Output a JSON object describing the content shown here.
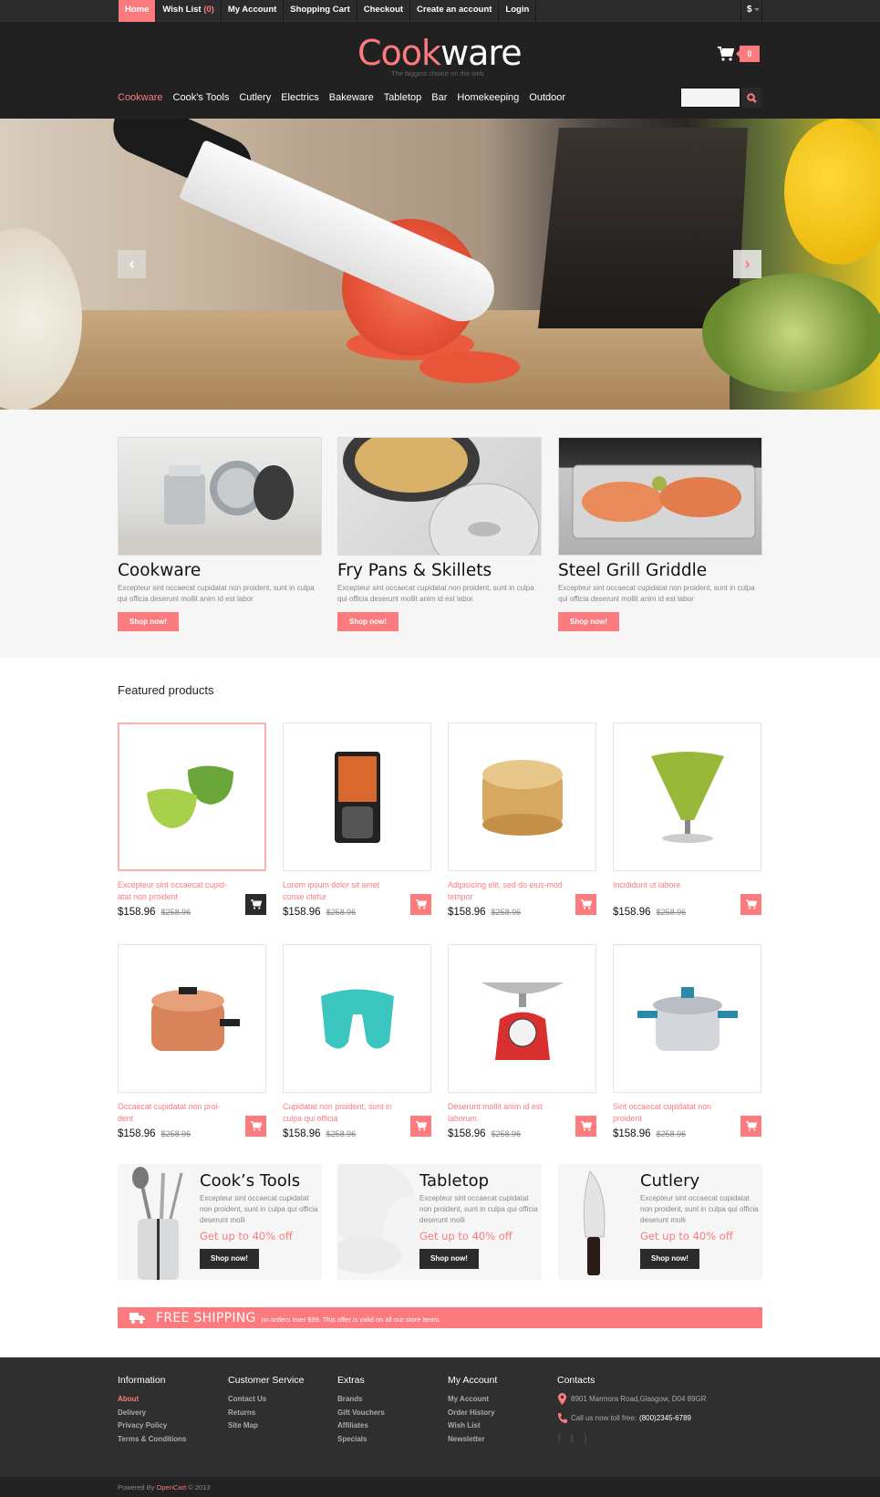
{
  "topbar": {
    "links": [
      {
        "label": "Home",
        "active": true
      },
      {
        "label": "Wish List",
        "count": "(0)"
      },
      {
        "label": "My Account"
      },
      {
        "label": "Shopping Cart"
      },
      {
        "label": "Checkout"
      },
      {
        "label": "Create an account"
      },
      {
        "label": "Login"
      }
    ],
    "currency": "$"
  },
  "header": {
    "logo_part1": "Cook",
    "logo_part2": "ware",
    "tagline": "The biggest choice on the web",
    "cart_count": "0",
    "search_placeholder": ""
  },
  "nav": {
    "items": [
      "Cookware",
      "Cook's Tools",
      "Cutlery",
      "Electrics",
      "Bakeware",
      "Tabletop",
      "Bar",
      "Homekeeping",
      "Outdoor"
    ],
    "active_index": 0
  },
  "hero": {
    "prev_icon": "‹",
    "next_icon": "›"
  },
  "categories": [
    {
      "title": "Cookware",
      "text": "Excepteur sint occaecat cupidatat non proident, sunt in culpa qui officia deserunt mollit anim id est labor",
      "button": "Shop now!"
    },
    {
      "title": "Fry Pans & Skillets",
      "text": "Excepteur sint occaecat cupidatat non proident, sunt in culpa qui officia deserunt mollit anim id est labor",
      "button": "Shop now!"
    },
    {
      "title": "Steel Grill Griddle",
      "text": "Excepteur sint occaecat cupidatat non proident, sunt in culpa qui officia deserunt mollit anim id est labor",
      "button": "Shop now!"
    }
  ],
  "featured": {
    "title": "Featured products",
    "products": [
      {
        "name": "Excepteur sint occaecat cupid-atat non proident",
        "price": "$158.96",
        "old_price": "$258.96",
        "image": "egg-poachers"
      },
      {
        "name": "Lorem ipsum dolor sit amet conse ctetur",
        "price": "$158.96",
        "old_price": "$258.96",
        "image": "coffee-maker"
      },
      {
        "name": "Adipisicing elit, sed do eius-mod tempor",
        "price": "$158.96",
        "old_price": "$258.96",
        "image": "bamboo-steamer"
      },
      {
        "name": "Incididunt ut labore",
        "price": "$158.96",
        "old_price": "$258.96",
        "image": "green-funnel"
      },
      {
        "name": "Occaecat cupidatat non proi-dent",
        "price": "$158.96",
        "old_price": "$258.96",
        "image": "copper-pot"
      },
      {
        "name": "Cupidatat non proident, sunt in culpa qui officia",
        "price": "$158.96",
        "old_price": "$258.96",
        "image": "sponge-holder"
      },
      {
        "name": "Deserunt mollit anim id est laborum.",
        "price": "$158.96",
        "old_price": "$258.96",
        "image": "kitchen-scale"
      },
      {
        "name": "Sint occaecat cupidatat non proident",
        "price": "$158.96",
        "old_price": "$258.96",
        "image": "pressure-cooker"
      }
    ]
  },
  "promos": [
    {
      "title": "Cook’s Tools",
      "text": "Excepteur sint occaecat cupidatat non proident, sunt in culpa qui officia deserunt molli",
      "offer": "Get up to 40% off",
      "button": "Shop now!"
    },
    {
      "title": "Tabletop",
      "text": "Excepteur sint occaecat cupidatat non proident, sunt in culpa qui officia deserunt molli",
      "offer": "Get up to 40% off",
      "button": "Shop now!"
    },
    {
      "title": "Cutlery",
      "text": "Excepteur sint occaecat cupidatat non proident, sunt in culpa qui officia deserunt molli",
      "offer": "Get up to 40% off",
      "button": "Shop now!"
    }
  ],
  "shipping": {
    "title": "FREE SHIPPING",
    "text": "on orders over $99. This offer is valid on all our store items."
  },
  "footer": {
    "columns": [
      {
        "title": "Information",
        "links": [
          "About",
          "Delivery",
          "Privacy Policy",
          "Terms & Conditions"
        ]
      },
      {
        "title": "Customer Service",
        "links": [
          "Contact Us",
          "Returns",
          "Site Map"
        ]
      },
      {
        "title": "Extras",
        "links": [
          "Brands",
          "Gift Vouchers",
          "Affiliates",
          "Specials"
        ]
      },
      {
        "title": "My Account",
        "links": [
          "My Account",
          "Order History",
          "Wish List",
          "Newsletter"
        ]
      }
    ],
    "contacts": {
      "title": "Contacts",
      "address": "8901 Marmora Road,Glasgow, D04 89GR",
      "phone_label": "Call us now toll free:",
      "phone": "(800)2345-6789",
      "socials": [
        "facebook-icon",
        "twitter-icon",
        "rss-icon"
      ]
    },
    "powered_prefix": "Powered By",
    "powered_brand": "OpenCart",
    "powered_suffix": "© 2013"
  },
  "colors": {
    "accent": "#fb7b7e",
    "dark": "#212121",
    "footer": "#2f2f2f"
  }
}
